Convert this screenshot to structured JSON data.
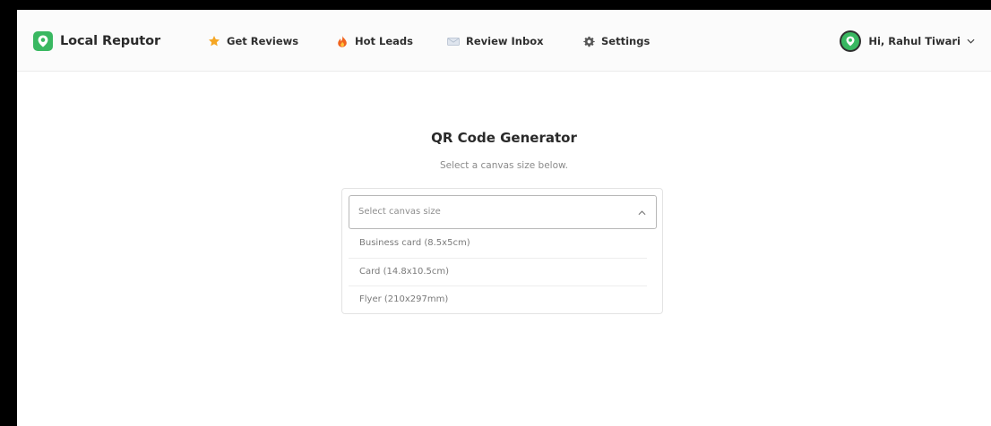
{
  "brand": {
    "name": "Local Reputor",
    "accent_color": "#39b861"
  },
  "nav": {
    "items": [
      {
        "label": "Get Reviews",
        "icon": "star-icon",
        "icon_color": "#f5a623"
      },
      {
        "label": "Hot Leads",
        "icon": "flame-icon",
        "icon_color": "#f0641e"
      },
      {
        "label": "Review Inbox",
        "icon": "envelope-icon",
        "icon_color": "#a9b6c8"
      },
      {
        "label": "Settings",
        "icon": "gear-icon",
        "icon_color": "#555555"
      }
    ]
  },
  "user": {
    "greeting": "Hi, Rahul Tiwari",
    "avatar_icon": "location-pin-icon",
    "menu_icon": "chevron-down-icon"
  },
  "main": {
    "title": "QR Code Generator",
    "subtitle": "Select a canvas size below.",
    "select": {
      "placeholder": "Select canvas size",
      "expanded": true,
      "options": [
        "Business card (8.5x5cm)",
        "Card (14.8x10.5cm)",
        "Flyer (210x297mm)"
      ]
    }
  }
}
